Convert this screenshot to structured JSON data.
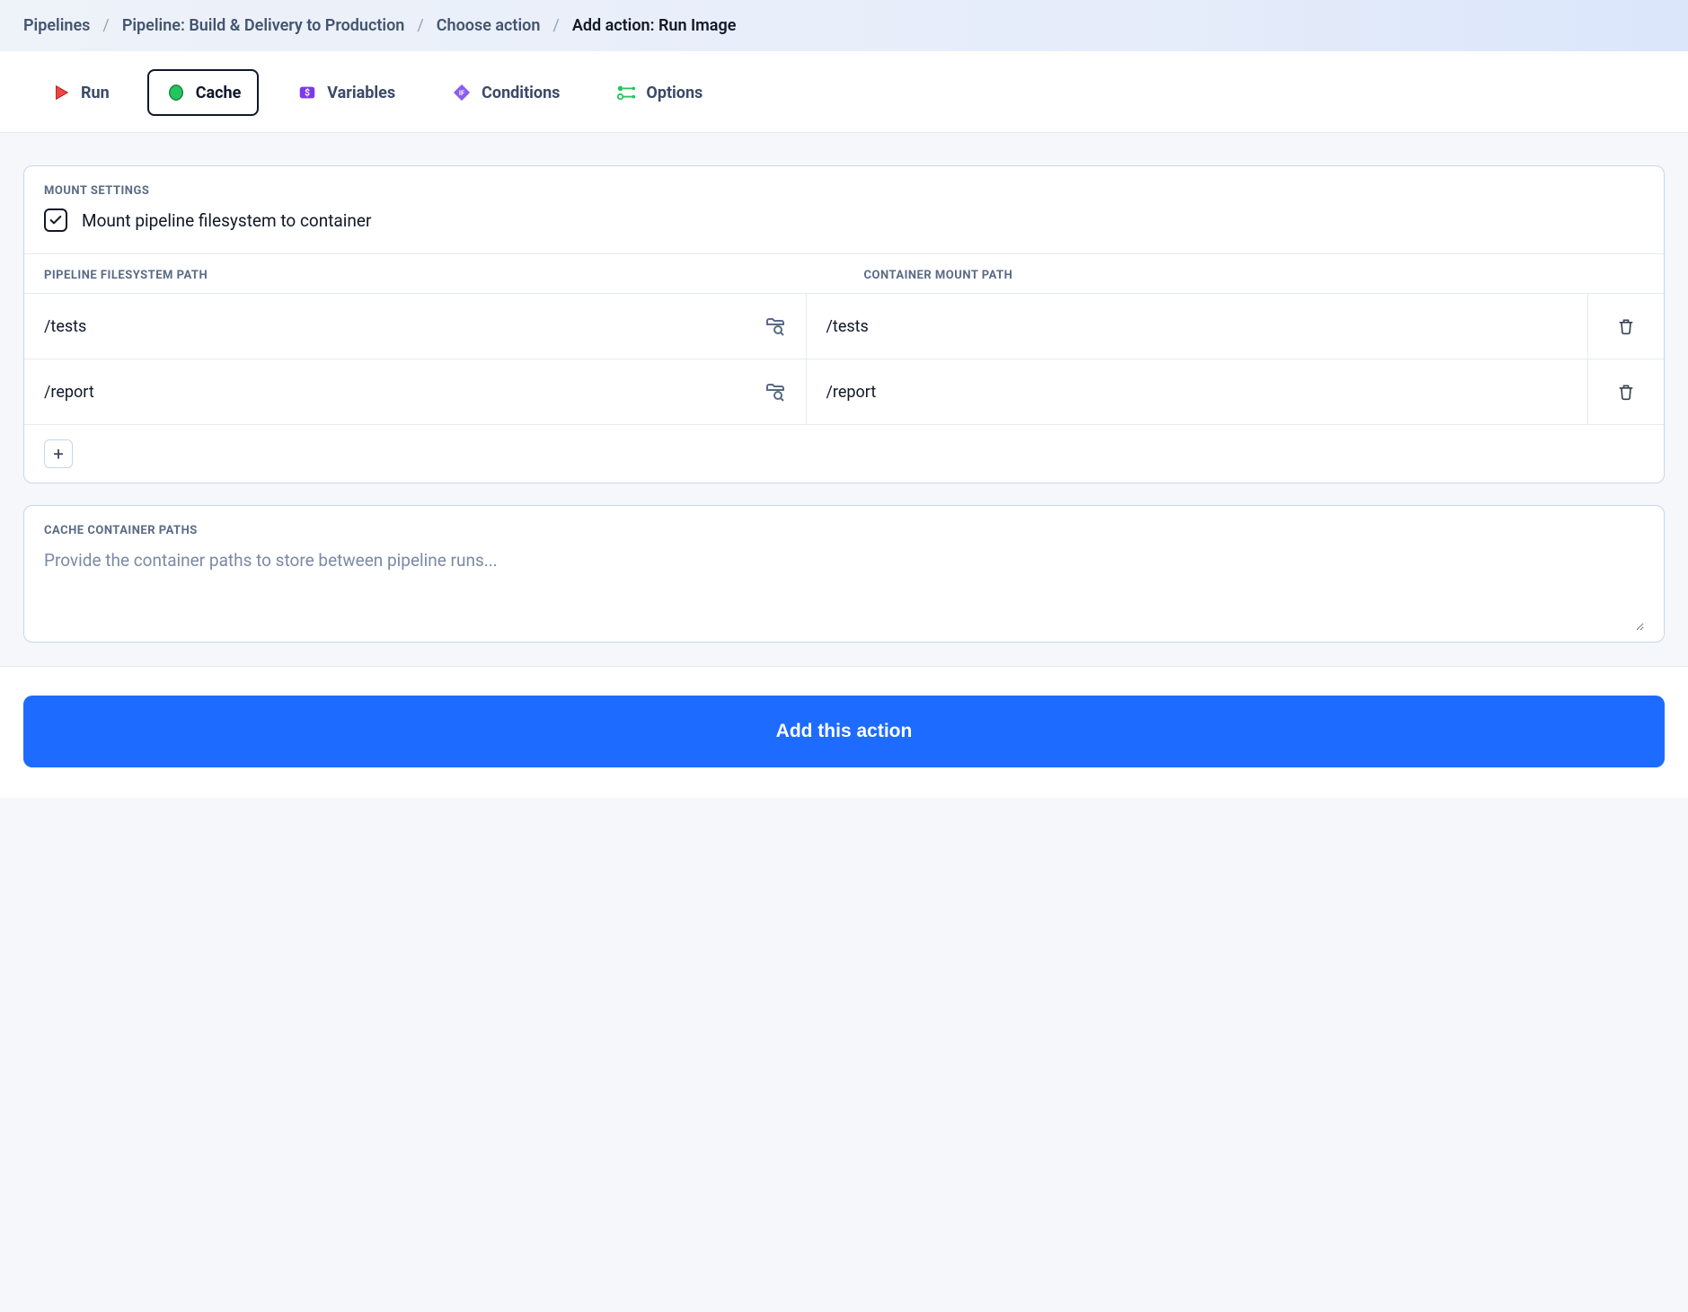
{
  "breadcrumb": {
    "items": [
      "Pipelines",
      "Pipeline: Build & Delivery to Production",
      "Choose action"
    ],
    "current": "Add action: Run Image"
  },
  "tabs": {
    "run": "Run",
    "cache": "Cache",
    "variables": "Variables",
    "conditions": "Conditions",
    "options": "Options"
  },
  "mount": {
    "section_label": "MOUNT SETTINGS",
    "checkbox_checked": true,
    "checkbox_label": "Mount pipeline filesystem to container",
    "col_pipeline": "PIPELINE FILESYSTEM PATH",
    "col_container": "CONTAINER MOUNT PATH",
    "rows": [
      {
        "pipeline": "/tests",
        "container": "/tests"
      },
      {
        "pipeline": "/report",
        "container": "/report"
      }
    ]
  },
  "cache": {
    "section_label": "CACHE CONTAINER PATHS",
    "placeholder": "Provide the container paths to store between pipeline runs...",
    "value": ""
  },
  "footer": {
    "submit_label": "Add this action"
  }
}
